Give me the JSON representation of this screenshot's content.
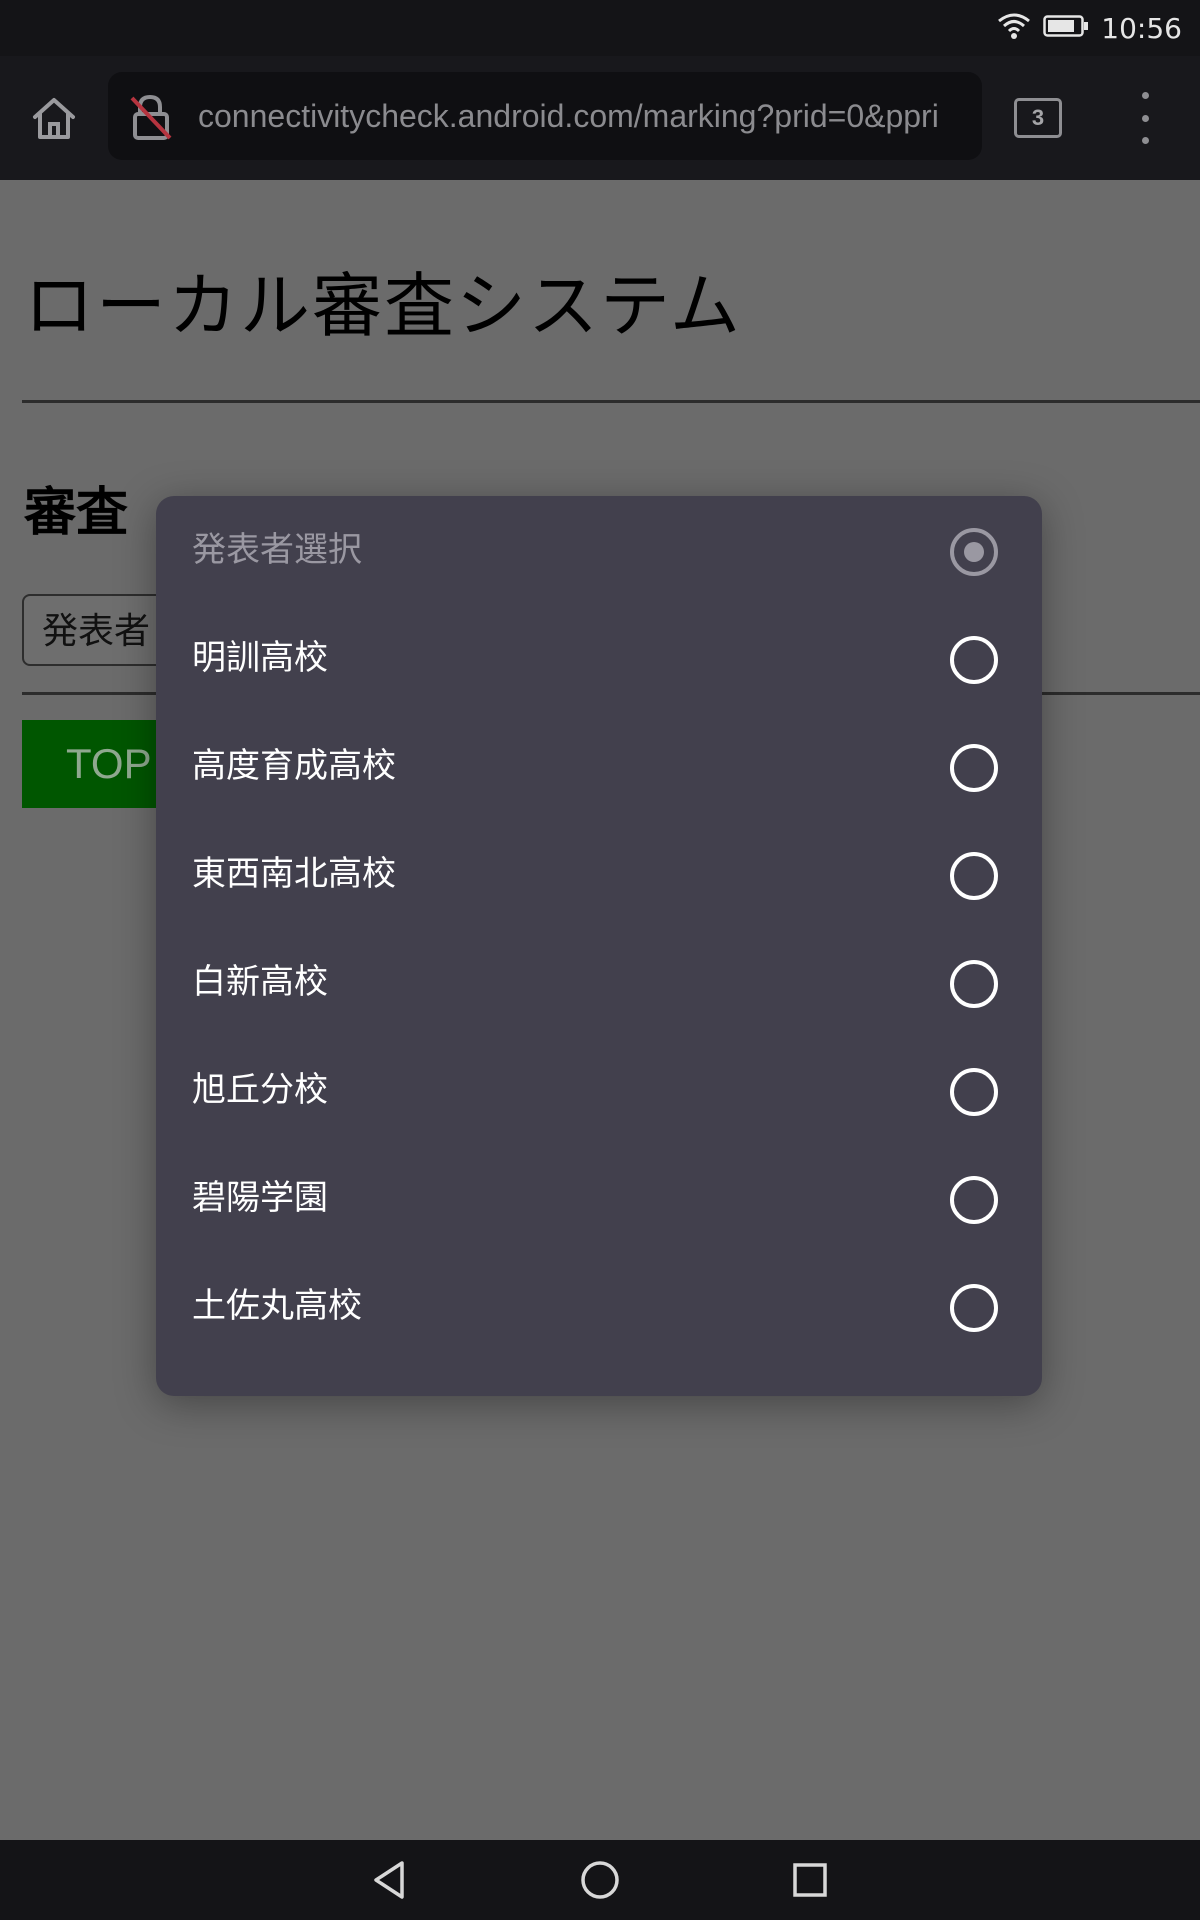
{
  "status_bar": {
    "time": "10:56",
    "icons": [
      "wifi-icon",
      "battery-icon"
    ]
  },
  "browser": {
    "url": "connectivitycheck.android.com/marking?prid=0&ppri",
    "tab_count": "3",
    "icons": [
      "home-icon",
      "insecure-lock-icon",
      "more-vert-icon"
    ]
  },
  "page": {
    "title": "ローカル審査システム",
    "section_title": "審査",
    "presenter_select_value": "発表者",
    "top_button_label": "TOP"
  },
  "dialog": {
    "options": [
      {
        "label": "発表者選択",
        "selected": true,
        "disabled": true
      },
      {
        "label": "明訓高校",
        "selected": false
      },
      {
        "label": "高度育成高校",
        "selected": false
      },
      {
        "label": "東西南北高校",
        "selected": false
      },
      {
        "label": "白新高校",
        "selected": false
      },
      {
        "label": "旭丘分校",
        "selected": false
      },
      {
        "label": "碧陽学園",
        "selected": false
      },
      {
        "label": "土佐丸高校",
        "selected": false
      }
    ]
  },
  "nav_bar": {
    "icons": [
      "back-icon",
      "home-circle-icon",
      "recents-icon"
    ]
  },
  "colors": {
    "dialog_bg": "#42404d",
    "top_button": "#005600",
    "scrim": "#6b6b6b"
  }
}
